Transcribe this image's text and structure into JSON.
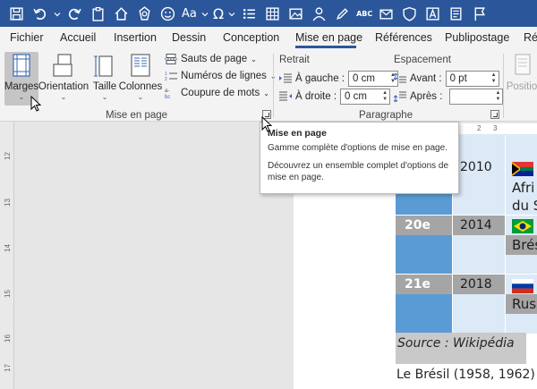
{
  "quick_access": {
    "items": [
      "save-icon",
      "undo-icon",
      "undo-dropdown-icon",
      "redo-icon",
      "clipboard-icon",
      "home-icon",
      "sun-icon",
      "smiley-icon",
      "font-case",
      "omega-icon",
      "bullets-icon",
      "table-icon",
      "image-icon",
      "person-icon",
      "pencil-icon",
      "abc-icon",
      "envelope-icon",
      "shield-icon",
      "a-box-icon",
      "spreadsheet-icon",
      "flag-icon"
    ],
    "font_case_label": "Aa",
    "abc_label": "ABC"
  },
  "tabs": [
    {
      "label": "Fichier"
    },
    {
      "label": "Accueil"
    },
    {
      "label": "Insertion"
    },
    {
      "label": "Dessin"
    },
    {
      "label": "Conception"
    },
    {
      "label": "Mise en page",
      "active": true
    },
    {
      "label": "Références"
    },
    {
      "label": "Publipostage"
    },
    {
      "label": "Ré"
    }
  ],
  "ribbon": {
    "margins_label": "Marges",
    "orientation_label": "Orientation",
    "size_label": "Taille",
    "columns_label": "Colonnes",
    "breaks_label": "Sauts de page",
    "line_numbers_label": "Numéros de lignes",
    "hyphenation_label": "Coupure de mots",
    "page_setup_group": "Mise en page",
    "indent_label": "Retrait",
    "indent_left_label": "À gauche :",
    "indent_left_value": "0 cm",
    "indent_right_label": "À droite :",
    "indent_right_value": "0 cm",
    "spacing_label": "Espacement",
    "spacing_before_label": "Avant :",
    "spacing_before_value": "0 pt",
    "spacing_after_label": "Après :",
    "spacing_after_value": "",
    "paragraph_group": "Paragraphe",
    "position_label": "Positio"
  },
  "tooltip": {
    "title": "Mise en page",
    "line1": "Gamme complète d'options de mise en page.",
    "line2a": "Découvrez un ensemble complet d'options de",
    "line2b": "mise en page."
  },
  "vruler_numbers": [
    "12",
    "13",
    "14",
    "15",
    "16",
    "17"
  ],
  "hruler_numbers": [
    "2",
    "3"
  ],
  "table": {
    "rows": [
      {
        "edition": "",
        "year": "2010",
        "country_lines": [
          "Afri",
          "du S"
        ],
        "flag": "south-africa"
      },
      {
        "edition": "20e",
        "year": "2014",
        "country_lines": [
          "Brés"
        ],
        "flag": "brazil"
      },
      {
        "edition": "21e",
        "year": "2018",
        "country_lines": [
          "Rus"
        ],
        "flag": "russia"
      }
    ]
  },
  "source_text": "Source : Wikipédia",
  "body_text": "Le Brésil (1958, 1962)",
  "colors": {
    "title_bar": "#2b579a",
    "table_blue": "#5b9bd5",
    "table_light_blue": "#dce9f6",
    "table_gray": "#a5a5a5"
  }
}
